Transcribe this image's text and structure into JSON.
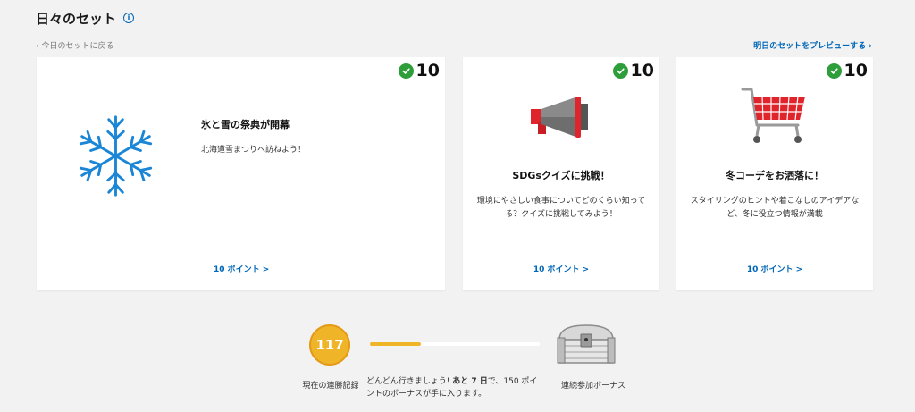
{
  "header": {
    "title": "日々のセット",
    "info_icon": "i",
    "back_link": "‹ 今日のセットに戻る",
    "preview_link": "明日のセットをプレビューする ›"
  },
  "cards": [
    {
      "badge_points": "10",
      "title": "氷と雪の祭典が開幕",
      "description": "北海道雪まつりへ訪ねよう！",
      "points_link": "10 ポイント >",
      "icon": "snowflake-icon",
      "icon_color": "#1b86d6"
    },
    {
      "badge_points": "10",
      "title": "SDGsクイズに挑戦！",
      "description": "環境にやさしい食事についてどのくらい知ってる？クイズに挑戦してみよう！",
      "points_link": "10 ポイント >",
      "icon": "megaphone-icon",
      "icon_color": "#e0242c"
    },
    {
      "badge_points": "10",
      "title": "冬コーデをお洒落に！",
      "description": "スタイリングのヒントや着こなしのアイデアなど、冬に役立つ情報が満載",
      "points_link": "10 ポイント >",
      "icon": "shopping-cart-icon",
      "icon_color": "#e0242c"
    }
  ],
  "streak": {
    "count": "117",
    "label": "現在の連勝記録",
    "progress_fraction": 0.3,
    "message_pre": "どんどん行きましょう! ",
    "message_bold": "あと 7 日",
    "message_post": "で、150 ポイントのボーナスが手に入ります。",
    "bonus_label": "連続参加ボーナス",
    "bonus_icon": "treasure-chest-icon"
  },
  "colors": {
    "accent_blue": "#0067b8",
    "check_green": "#2e9e3a",
    "streak_gold": "#f0b429"
  }
}
